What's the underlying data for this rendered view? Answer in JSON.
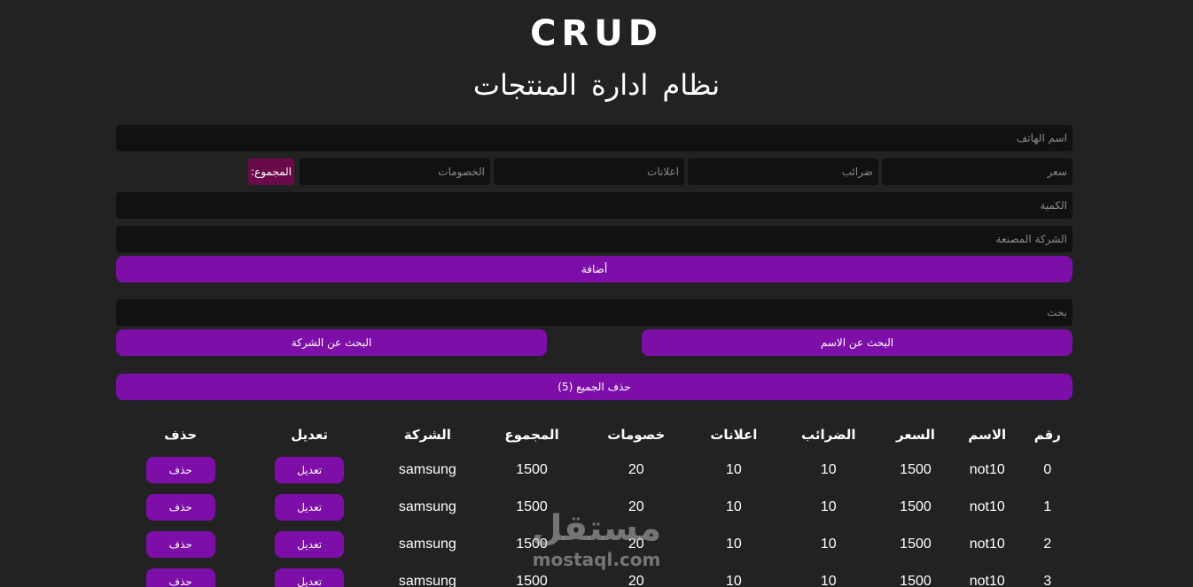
{
  "header": {
    "title": "CRUD",
    "subtitle": "نظام ادارة المنتجات"
  },
  "form": {
    "title_placeholder": "اسم الهاتف",
    "price_placeholder": "سعر",
    "taxes_placeholder": "ضرائب",
    "ads_placeholder": "اعلانات",
    "discount_placeholder": "الخصومات",
    "total_label": "المجموع:",
    "count_placeholder": "الكمية",
    "category_placeholder": "الشركة المصنعة",
    "create_label": "أضافة"
  },
  "search": {
    "placeholder": "بحث",
    "by_title_label": "البحث عن الاسم",
    "by_category_label": "البحث عن الشركة"
  },
  "delete_all": {
    "label": "حذف الجميع (5)"
  },
  "table": {
    "headers": {
      "id": "رقم",
      "title": "الاسم",
      "price": "السعر",
      "taxes": "الضرائب",
      "ads": "اعلانات",
      "discount": "خصومات",
      "total": "المجموع",
      "category": "الشركة",
      "update": "تعديل",
      "delete": "حذف"
    },
    "rows": [
      {
        "id": "0",
        "title": "not10",
        "price": "1500",
        "taxes": "10",
        "ads": "10",
        "discount": "20",
        "total": "1500",
        "category": "samsung",
        "update": "تعديل",
        "delete": "حذف"
      },
      {
        "id": "1",
        "title": "not10",
        "price": "1500",
        "taxes": "10",
        "ads": "10",
        "discount": "20",
        "total": "1500",
        "category": "samsung",
        "update": "تعديل",
        "delete": "حذف"
      },
      {
        "id": "2",
        "title": "not10",
        "price": "1500",
        "taxes": "10",
        "ads": "10",
        "discount": "20",
        "total": "1500",
        "category": "samsung",
        "update": "تعديل",
        "delete": "حذف"
      },
      {
        "id": "3",
        "title": "not10",
        "price": "1500",
        "taxes": "10",
        "ads": "10",
        "discount": "20",
        "total": "1500",
        "category": "samsung",
        "update": "تعديل",
        "delete": "حذف"
      }
    ]
  },
  "watermark": {
    "arabic": "مستقل",
    "english": "mostaql.com"
  },
  "colors": {
    "background": "#222222",
    "input": "#111111",
    "accent": "#7d0fa8",
    "total_badge": "#6b0a4a"
  }
}
